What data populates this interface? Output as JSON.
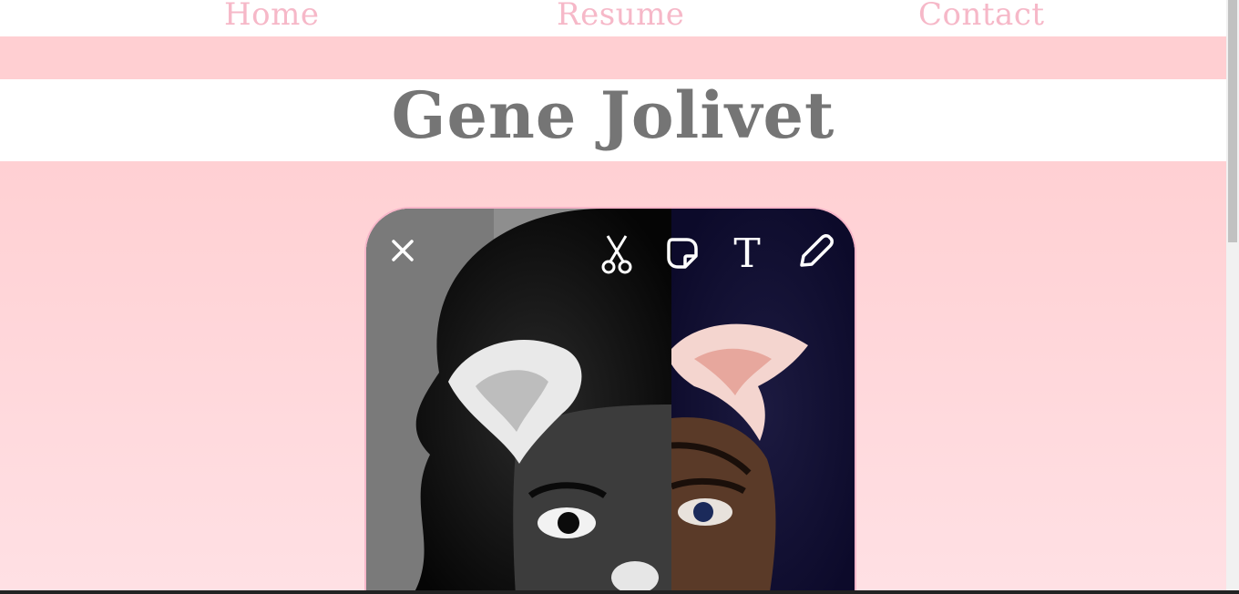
{
  "nav": {
    "items": [
      "Home",
      "Resume",
      "Contact"
    ]
  },
  "header": {
    "title": "Gene Jolivet"
  },
  "photo": {
    "toolbar": [
      "close-icon",
      "scissors-icon",
      "sticker-icon",
      "text-icon",
      "pencil-icon"
    ],
    "text_tool_label": "T"
  },
  "colors": {
    "nav_text": "#f6b8c8",
    "band": "#ffcfd2",
    "title_text": "#757575"
  }
}
